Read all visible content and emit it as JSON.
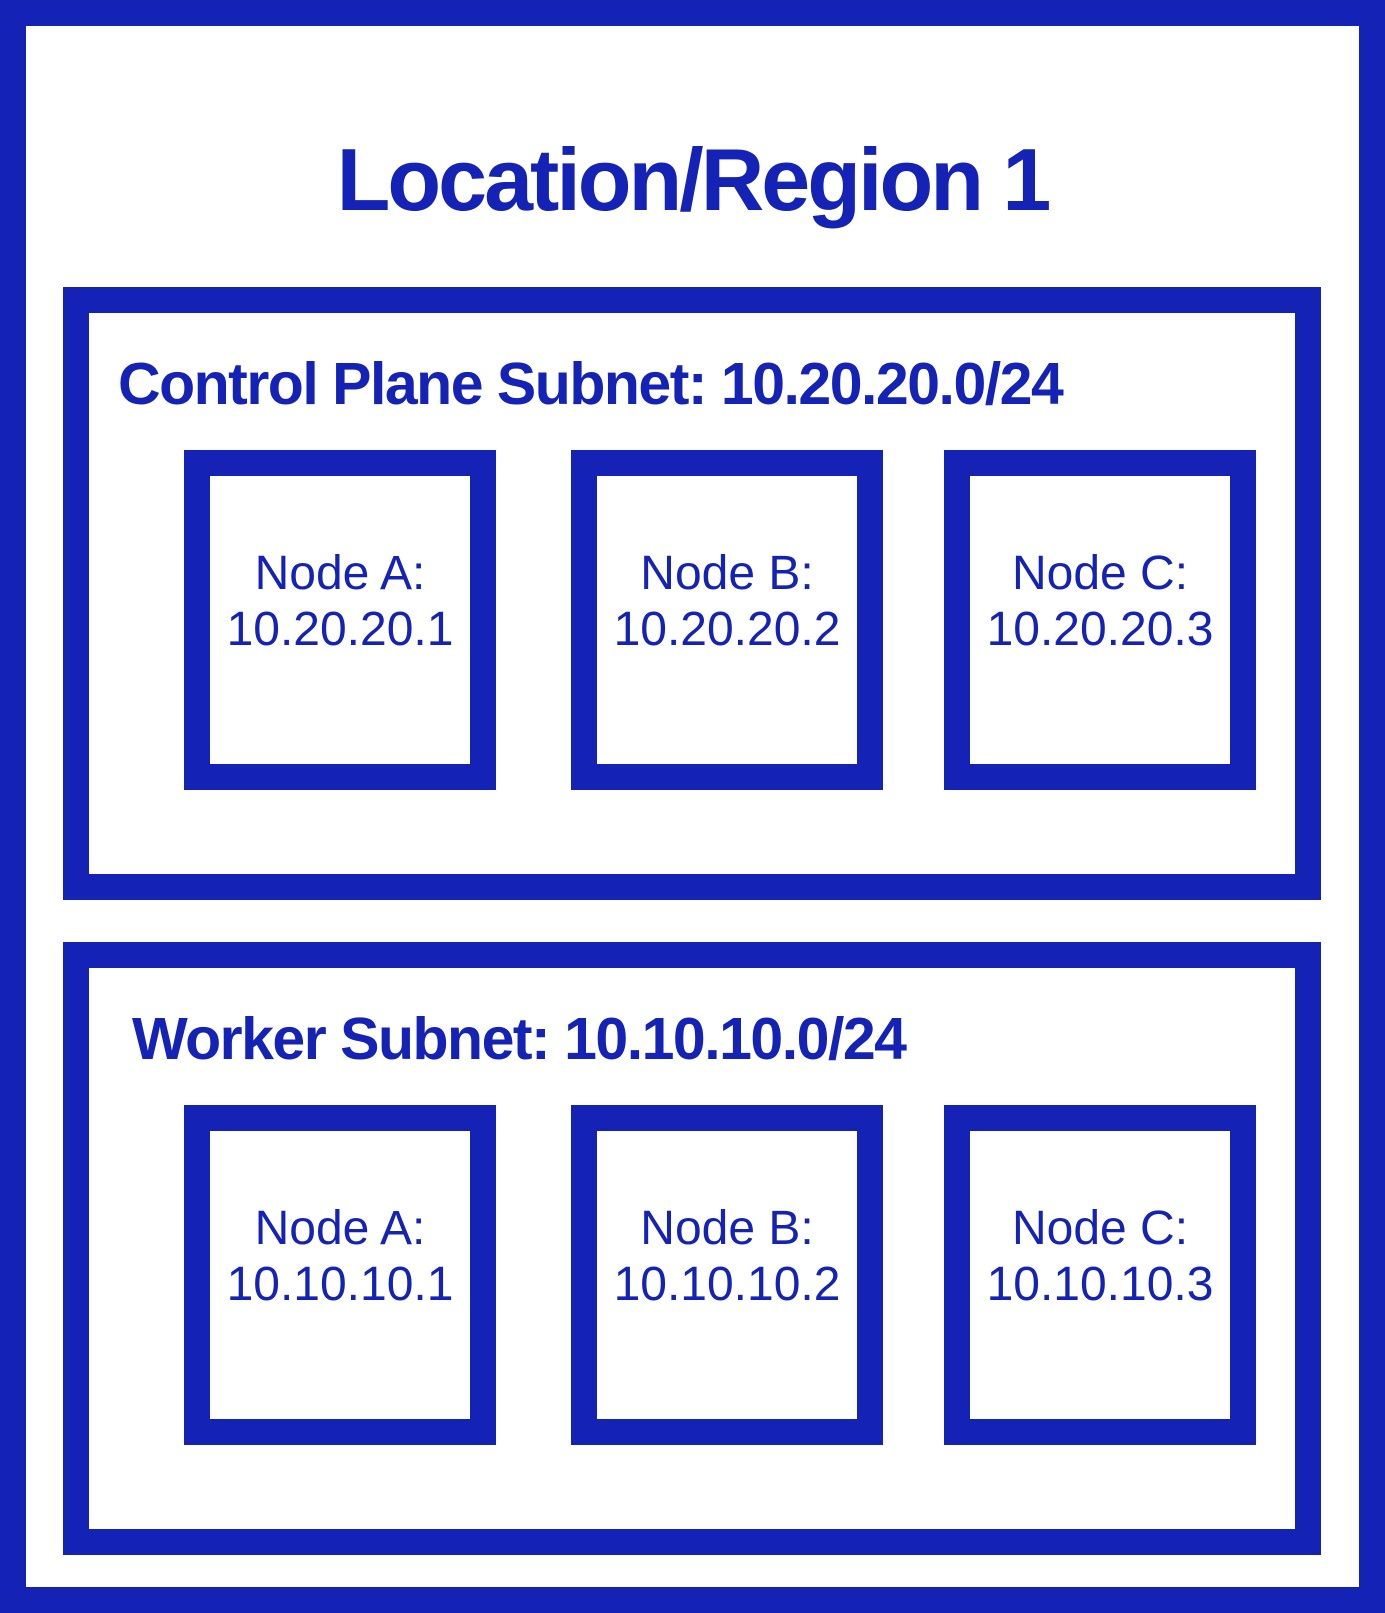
{
  "colors": {
    "accent": "#1422b5",
    "background": "#ffffff"
  },
  "region": {
    "title": "Location/Region 1"
  },
  "subnets": [
    {
      "label": "Control Plane Subnet: 10.20.20.0/24",
      "nodes": [
        {
          "name": "Node A:",
          "ip": "10.20.20.1"
        },
        {
          "name": "Node B:",
          "ip": "10.20.20.2"
        },
        {
          "name": "Node C:",
          "ip": "10.20.20.3"
        }
      ]
    },
    {
      "label": "Worker Subnet: 10.10.10.0/24",
      "nodes": [
        {
          "name": "Node A:",
          "ip": "10.10.10.1"
        },
        {
          "name": "Node B:",
          "ip": "10.10.10.2"
        },
        {
          "name": "Node C:",
          "ip": "10.10.10.3"
        }
      ]
    }
  ]
}
